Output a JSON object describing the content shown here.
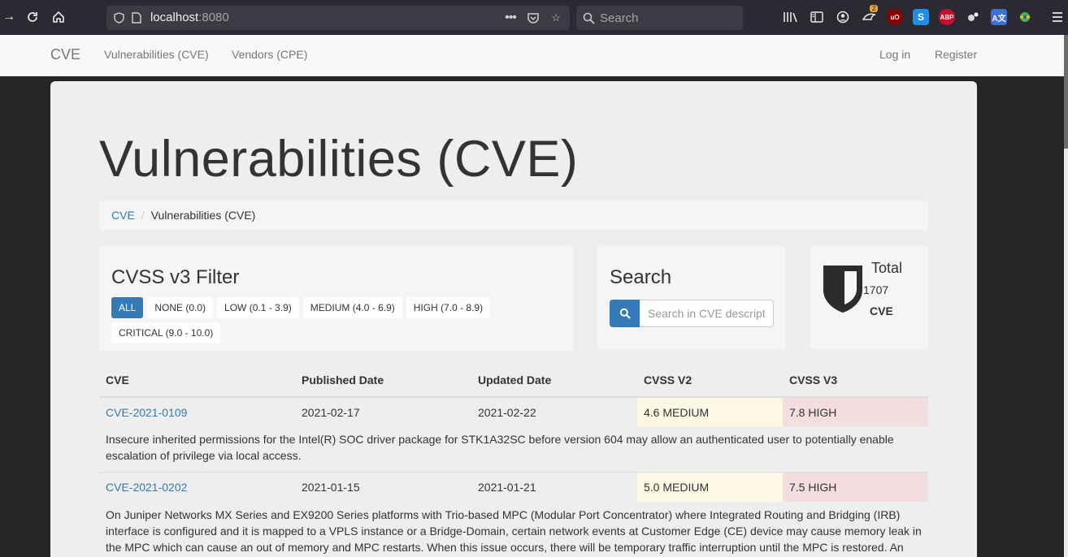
{
  "browser": {
    "url_host": "localhost",
    "url_port": ":8080",
    "search_placeholder": "Search",
    "badge_count": "2"
  },
  "navbar": {
    "brand": "CVE",
    "links": [
      "Vulnerabilities (CVE)",
      "Vendors (CPE)"
    ],
    "login": "Log in",
    "register": "Register"
  },
  "page": {
    "title": "Vulnerabilities (CVE)",
    "breadcrumb": [
      "CVE",
      "Vulnerabilities (CVE)"
    ]
  },
  "filter": {
    "title": "CVSS v3 Filter",
    "buttons": [
      "ALL",
      "NONE (0.0)",
      "LOW (0.1 - 3.9)",
      "MEDIUM (4.0 - 6.9)",
      "HIGH (7.0 - 8.9)",
      "CRITICAL (9.0 - 10.0)"
    ],
    "active": "ALL"
  },
  "search": {
    "title": "Search",
    "placeholder": "Search in CVE description"
  },
  "total": {
    "label": "Total",
    "count": "1707",
    "unit": "CVE"
  },
  "table": {
    "headers": [
      "CVE",
      "Published Date",
      "Updated Date",
      "CVSS V2",
      "CVSS V3"
    ],
    "rows": [
      {
        "id": "CVE-2021-0109",
        "published": "2021-02-17",
        "updated": "2021-02-22",
        "cvss2": "4.6 MEDIUM",
        "cvss3": "7.8 HIGH",
        "description": "Insecure inherited permissions for the Intel(R) SOC driver package for STK1A32SC before version 604 may allow an authenticated user to potentially enable escalation of privilege via local access."
      },
      {
        "id": "CVE-2021-0202",
        "published": "2021-01-15",
        "updated": "2021-01-21",
        "cvss2": "5.0 MEDIUM",
        "cvss3": "7.5 HIGH",
        "description": "On Juniper Networks MX Series and EX9200 Series platforms with Trio-based MPC (Modular Port Concentrator) where Integrated Routing and Bridging (IRB) interface is configured and it is mapped to a VPLS instance or a Bridge-Domain, certain network events at Customer Edge (CE) device may cause memory leak in the MPC which can cause an out of memory and MPC restarts. When this issue occurs, there will be temporary traffic interruption until the MPC is restored. An"
      }
    ]
  },
  "colors": {
    "primary": "#337ab7",
    "warning_bg": "#fcf8e3",
    "danger_bg": "#f2dede"
  }
}
